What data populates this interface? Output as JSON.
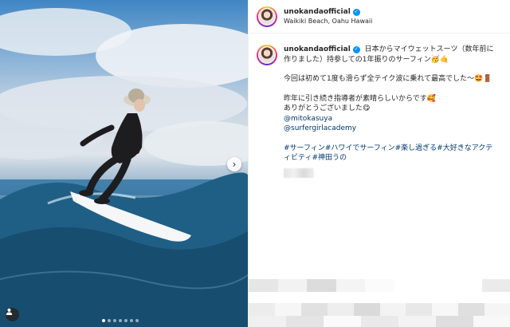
{
  "post": {
    "username": "unokandaofficial",
    "location": "Waikiki Beach, Oahu Hawaii",
    "caption": {
      "line1": "日本からマイウェットスーツ（数年前に作りました）持参しての1年振りのサーフィン🥳🤙",
      "line2": "今回は初めて1度も滑らず全テイク波に乗れて最高でした〜🤩🚪",
      "line3": "昨年に引き続き指導者が素晴らしいからです🥰",
      "line4": "ありがとうございました😋",
      "mentions": [
        "@mitokasuya",
        "@surfergirlacademy"
      ],
      "hashtags": "#サーフィン#ハワイでサーフィン#楽し過ぎる#大好きなアクティビティ#神田うの"
    }
  },
  "media": {
    "carousel_count": 7,
    "active_index": 0,
    "next_icon": "chevron-right-icon",
    "tag_icon": "user-tag-icon"
  }
}
